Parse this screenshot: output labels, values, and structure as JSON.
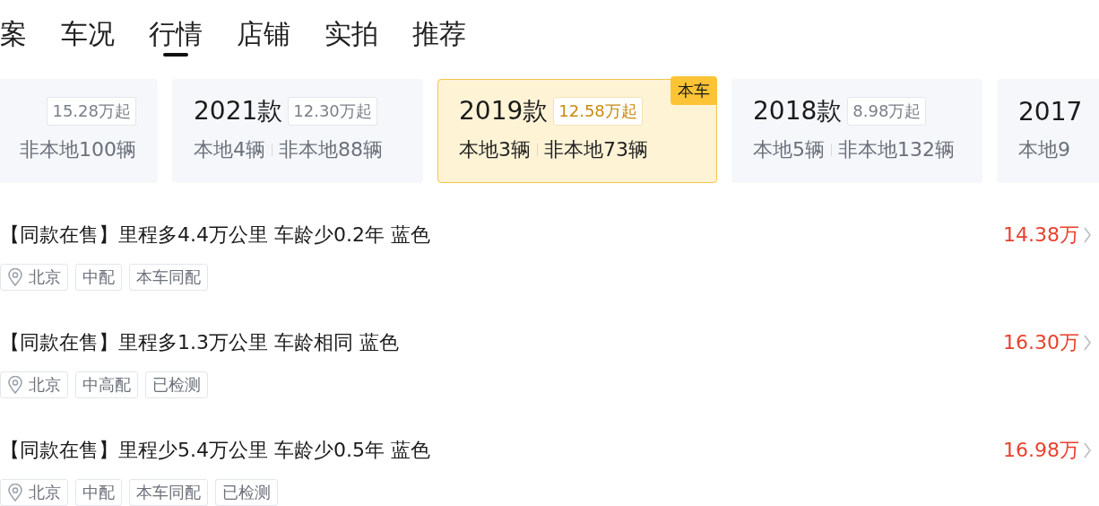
{
  "tabs": [
    {
      "label": "案",
      "selected": false
    },
    {
      "label": "车况",
      "selected": false
    },
    {
      "label": "行情",
      "selected": true
    },
    {
      "label": "店铺",
      "selected": false
    },
    {
      "label": "实拍",
      "selected": false
    },
    {
      "label": "推荐",
      "selected": false
    }
  ],
  "year_cards": [
    {
      "price": "15.28万起",
      "nonlocal": "非本地100辆",
      "selected": false
    },
    {
      "year": "2021款",
      "price": "12.30万起",
      "local": "本地4辆",
      "nonlocal": "非本地88辆",
      "selected": false
    },
    {
      "year": "2019款",
      "price": "12.58万起",
      "local": "本地3辆",
      "nonlocal": "非本地73辆",
      "selected": true,
      "badge": "本车"
    },
    {
      "year": "2018款",
      "price": "8.98万起",
      "local": "本地5辆",
      "nonlocal": "非本地132辆",
      "selected": false
    },
    {
      "year": "2017",
      "local": "本地9",
      "selected": false
    }
  ],
  "listings": [
    {
      "title": "【同款在售】里程多4.4万公里 车龄少0.2年 蓝色",
      "price": "14.38万",
      "tags": [
        {
          "kind": "location",
          "text": "北京"
        },
        {
          "kind": "plain",
          "text": "中配"
        },
        {
          "kind": "plain",
          "text": "本车同配"
        }
      ]
    },
    {
      "title": "【同款在售】里程多1.3万公里 车龄相同 蓝色",
      "price": "16.30万",
      "tags": [
        {
          "kind": "location",
          "text": "北京"
        },
        {
          "kind": "plain",
          "text": "中高配"
        },
        {
          "kind": "plain",
          "text": "已检测"
        }
      ]
    },
    {
      "title": "【同款在售】里程少5.4万公里 车龄少0.5年 蓝色",
      "price": "16.98万",
      "tags": [
        {
          "kind": "location",
          "text": "北京"
        },
        {
          "kind": "plain",
          "text": "中配"
        },
        {
          "kind": "plain",
          "text": "本车同配"
        },
        {
          "kind": "plain",
          "text": "已检测"
        }
      ]
    }
  ]
}
